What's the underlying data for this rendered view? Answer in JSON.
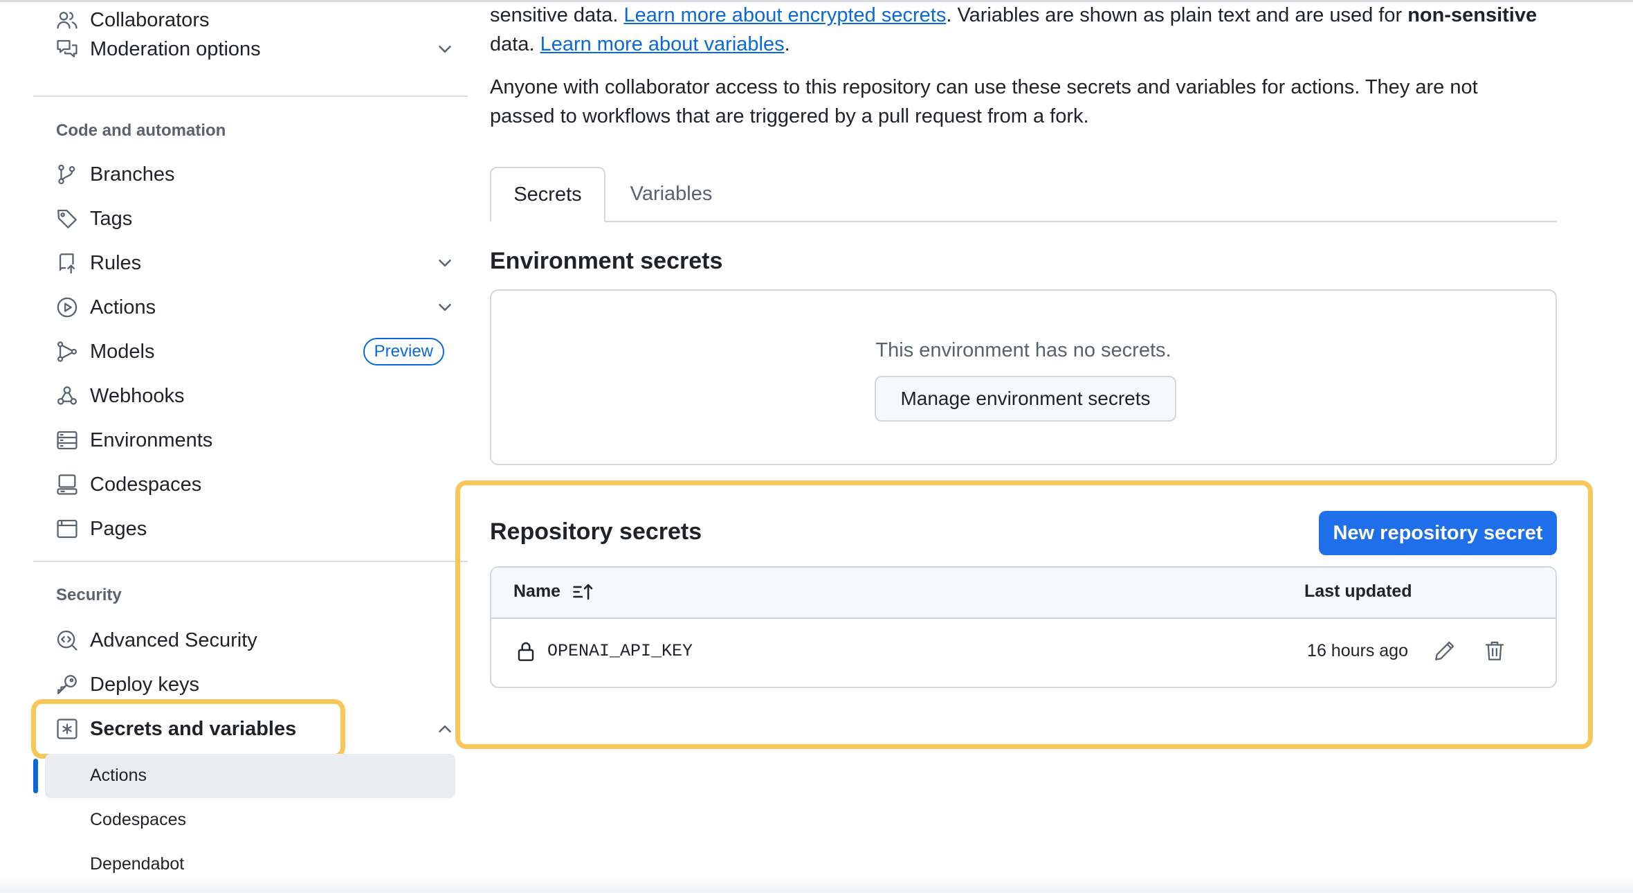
{
  "sidebar": {
    "top_items": [
      {
        "label": "Collaborators",
        "icon": "people-icon"
      },
      {
        "label": "Moderation options",
        "icon": "comment-discussion-icon"
      }
    ],
    "code_heading": "Code and automation",
    "code_items": [
      {
        "label": "Branches",
        "icon": "git-branch-icon"
      },
      {
        "label": "Tags",
        "icon": "tag-icon"
      },
      {
        "label": "Rules",
        "icon": "repo-push-icon"
      },
      {
        "label": "Actions",
        "icon": "play-icon"
      },
      {
        "label": "Models",
        "icon": "models-icon",
        "badge": "Preview"
      },
      {
        "label": "Webhooks",
        "icon": "webhook-icon"
      },
      {
        "label": "Environments",
        "icon": "server-icon"
      },
      {
        "label": "Codespaces",
        "icon": "codespaces-icon"
      },
      {
        "label": "Pages",
        "icon": "browser-icon"
      }
    ],
    "security_heading": "Security",
    "security_items": [
      {
        "label": "Advanced Security",
        "icon": "codescan-icon"
      },
      {
        "label": "Deploy keys",
        "icon": "key-icon"
      },
      {
        "label": "Secrets and variables",
        "icon": "key-asterisk-icon",
        "expanded": true
      }
    ],
    "sub_items": [
      {
        "label": "Actions",
        "active": true
      },
      {
        "label": "Codespaces"
      },
      {
        "label": "Dependabot"
      }
    ]
  },
  "main": {
    "intro": {
      "part1": "sensitive data. ",
      "link1": "Learn more about encrypted secrets",
      "part2": ". Variables are shown as plain text and are used for ",
      "bold": "non-sensitive",
      "part3": " data. ",
      "link2": "Learn more about variables",
      "part4": "."
    },
    "collab_note": "Anyone with collaborator access to this repository can use these secrets and variables for actions. They are not passed to workflows that are triggered by a pull request from a fork.",
    "tabs": [
      {
        "label": "Secrets",
        "active": true
      },
      {
        "label": "Variables"
      }
    ],
    "env_heading": "Environment secrets",
    "env_empty": "This environment has no secrets.",
    "env_button": "Manage environment secrets",
    "repo_heading": "Repository secrets",
    "repo_button": "New repository secret",
    "table": {
      "col_name": "Name",
      "col_updated": "Last updated",
      "rows": [
        {
          "name": "OPENAI_API_KEY",
          "updated": "16 hours ago"
        }
      ]
    }
  },
  "colors": {
    "accent": "#0969da",
    "primary_button": "#1f6feb",
    "highlight": "#f6c85a",
    "text": "#1f2328",
    "muted": "#59636e",
    "border": "#d0d7de"
  }
}
